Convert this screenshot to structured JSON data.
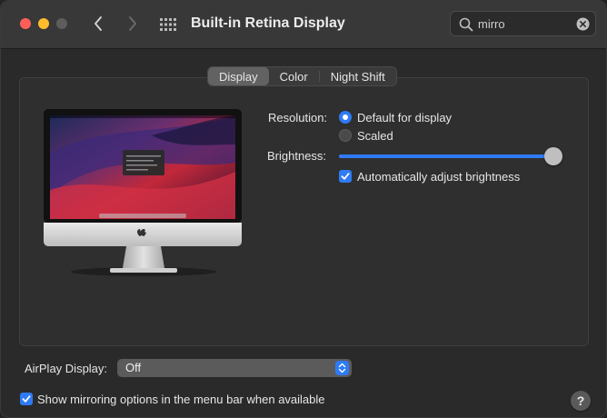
{
  "window": {
    "title": "Built-in Retina Display"
  },
  "search": {
    "value": "mirro",
    "icon": "search-icon"
  },
  "tabs": [
    {
      "label": "Display",
      "active": true
    },
    {
      "label": "Color",
      "active": false
    },
    {
      "label": "Night Shift",
      "active": false
    }
  ],
  "resolution": {
    "label": "Resolution:",
    "options": [
      {
        "label": "Default for display",
        "selected": true
      },
      {
        "label": "Scaled",
        "selected": false
      }
    ]
  },
  "brightness": {
    "label": "Brightness:",
    "level": 0.99,
    "auto_adjust_label": "Automatically adjust brightness",
    "auto_adjust_checked": true
  },
  "airplay": {
    "label": "AirPlay Display:",
    "value": "Off"
  },
  "mirroring": {
    "label": "Show mirroring options in the menu bar when available",
    "checked": true
  },
  "help": {
    "label": "?"
  },
  "colors": {
    "accent": "#2f7bf5",
    "close": "#ff5f57",
    "minimize": "#febc2e"
  }
}
